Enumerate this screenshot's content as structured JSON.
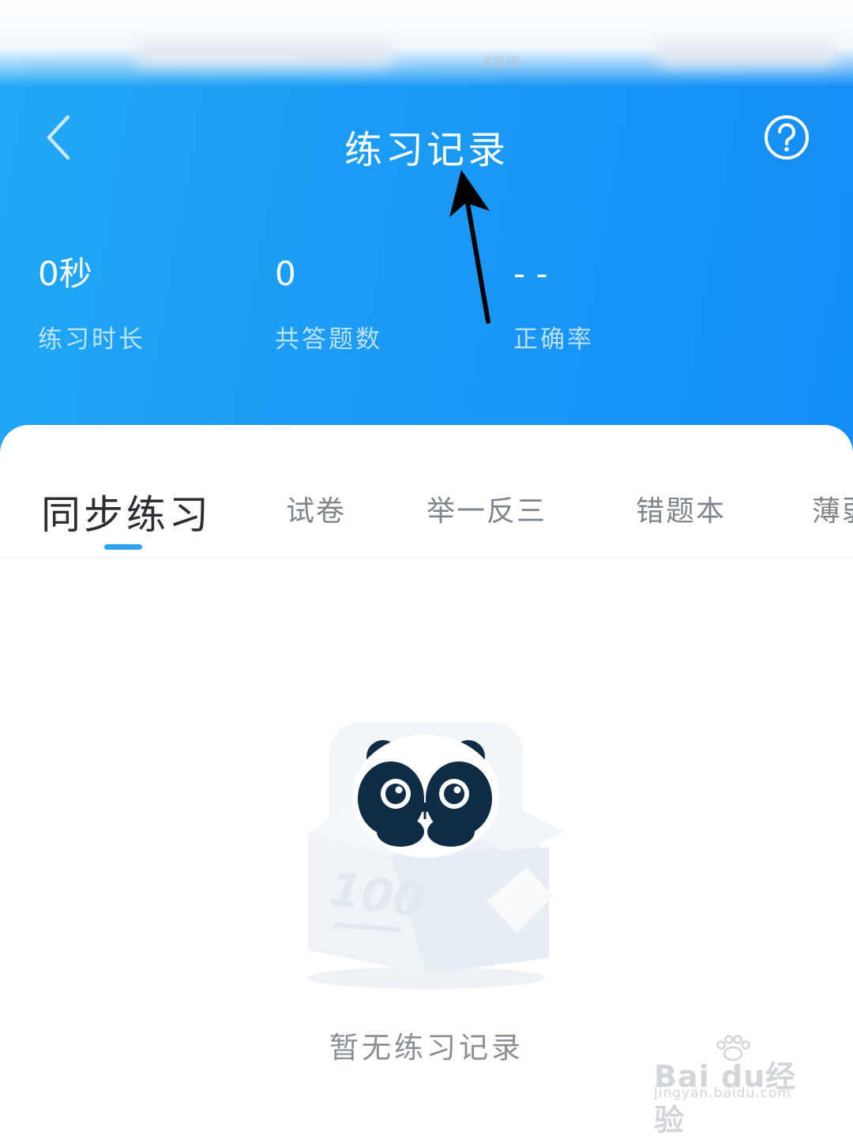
{
  "status_bar": {
    "speed": "KB/S"
  },
  "header": {
    "title": "练习记录",
    "back_icon": "chevron-left-icon",
    "help_icon": "help-circle-icon"
  },
  "stats": [
    {
      "value": "0秒",
      "label": "练习时长"
    },
    {
      "value": "0",
      "label": "共答题数"
    },
    {
      "value": "- -",
      "label": "正确率"
    }
  ],
  "tabs": [
    {
      "label": "同步练习",
      "active": true
    },
    {
      "label": "试卷",
      "active": false
    },
    {
      "label": "举一反三",
      "active": false
    },
    {
      "label": "错题本",
      "active": false
    },
    {
      "label": "薄弱",
      "active": false
    }
  ],
  "empty_state": {
    "message": "暂无练习记录",
    "box_label": "100",
    "illustration": "panda-in-box"
  },
  "watermark": {
    "main": "Bai du经验",
    "sub": "jingyan.baidu.com"
  },
  "colors": {
    "header_blue": "#1a98f5",
    "tab_indicator": "#2fa3f0",
    "annotation_arrow": "#000000"
  }
}
